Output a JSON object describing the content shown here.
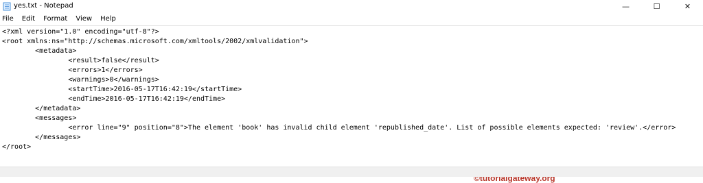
{
  "window": {
    "title": "yes.txt - Notepad",
    "controls": {
      "minimize": "—",
      "maximize": "☐",
      "close": "✕"
    }
  },
  "menu": {
    "items": [
      "File",
      "Edit",
      "Format",
      "View",
      "Help"
    ]
  },
  "editor": {
    "lines": [
      "<?xml version=\"1.0\" encoding=\"utf-8\"?>",
      "<root xmlns:ns=\"http://schemas.microsoft.com/xmltools/2002/xmlvalidation\">",
      "        <metadata>",
      "                <result>false</result>",
      "                <errors>1</errors>",
      "                <warnings>0</warnings>",
      "                <startTime>2016-05-17T16:42:19</startTime>",
      "                <endTime>2016-05-17T16:42:19</endTime>",
      "        </metadata>",
      "        <messages>",
      "                <error line=\"9\" position=\"8\">The element 'book' has invalid child element 'republished_date'. List of possible elements expected: 'review'.</error>",
      "        </messages>",
      "</root>"
    ]
  },
  "watermark": {
    "text": "©tutorialgateway.org"
  },
  "colors": {
    "watermark": "#b8362a",
    "app_icon": "#4a90d9"
  },
  "icons": {
    "app": "notepad-icon"
  }
}
